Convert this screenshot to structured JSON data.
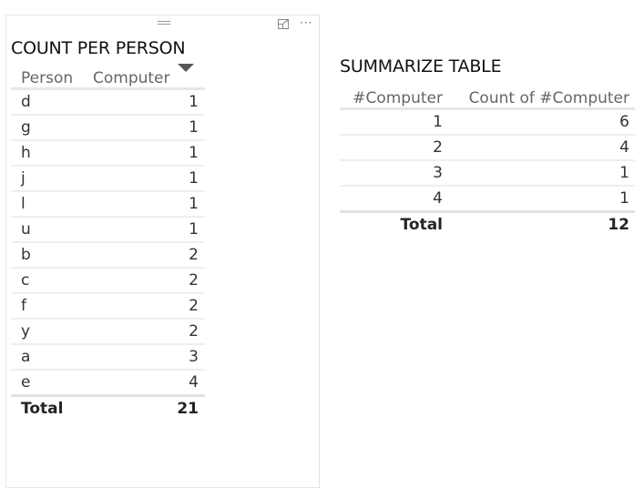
{
  "left_visual": {
    "title": "COUNT PER PERSON",
    "columns": [
      "Person",
      "Computer"
    ],
    "sort": "descending-on-Computer",
    "rows": [
      {
        "person": "d",
        "computer": "1"
      },
      {
        "person": "g",
        "computer": "1"
      },
      {
        "person": "h",
        "computer": "1"
      },
      {
        "person": "j",
        "computer": "1"
      },
      {
        "person": "l",
        "computer": "1"
      },
      {
        "person": "u",
        "computer": "1"
      },
      {
        "person": "b",
        "computer": "2"
      },
      {
        "person": "c",
        "computer": "2"
      },
      {
        "person": "f",
        "computer": "2"
      },
      {
        "person": "y",
        "computer": "2"
      },
      {
        "person": "a",
        "computer": "3"
      },
      {
        "person": "e",
        "computer": "4"
      }
    ],
    "total_label": "Total",
    "total_value": "21",
    "icons": {
      "drag": "drag-handle-icon",
      "focus": "focus-mode-icon",
      "more": "more-options-icon"
    },
    "more_glyph": "···"
  },
  "right_visual": {
    "title": "SUMMARIZE TABLE",
    "columns": [
      "#Computer",
      "Count of #Computer"
    ],
    "rows": [
      {
        "computer": "1",
        "count": "6"
      },
      {
        "computer": "2",
        "count": "4"
      },
      {
        "computer": "3",
        "count": "1"
      },
      {
        "computer": "4",
        "count": "1"
      }
    ],
    "total_label": "Total",
    "total_value": "12"
  }
}
